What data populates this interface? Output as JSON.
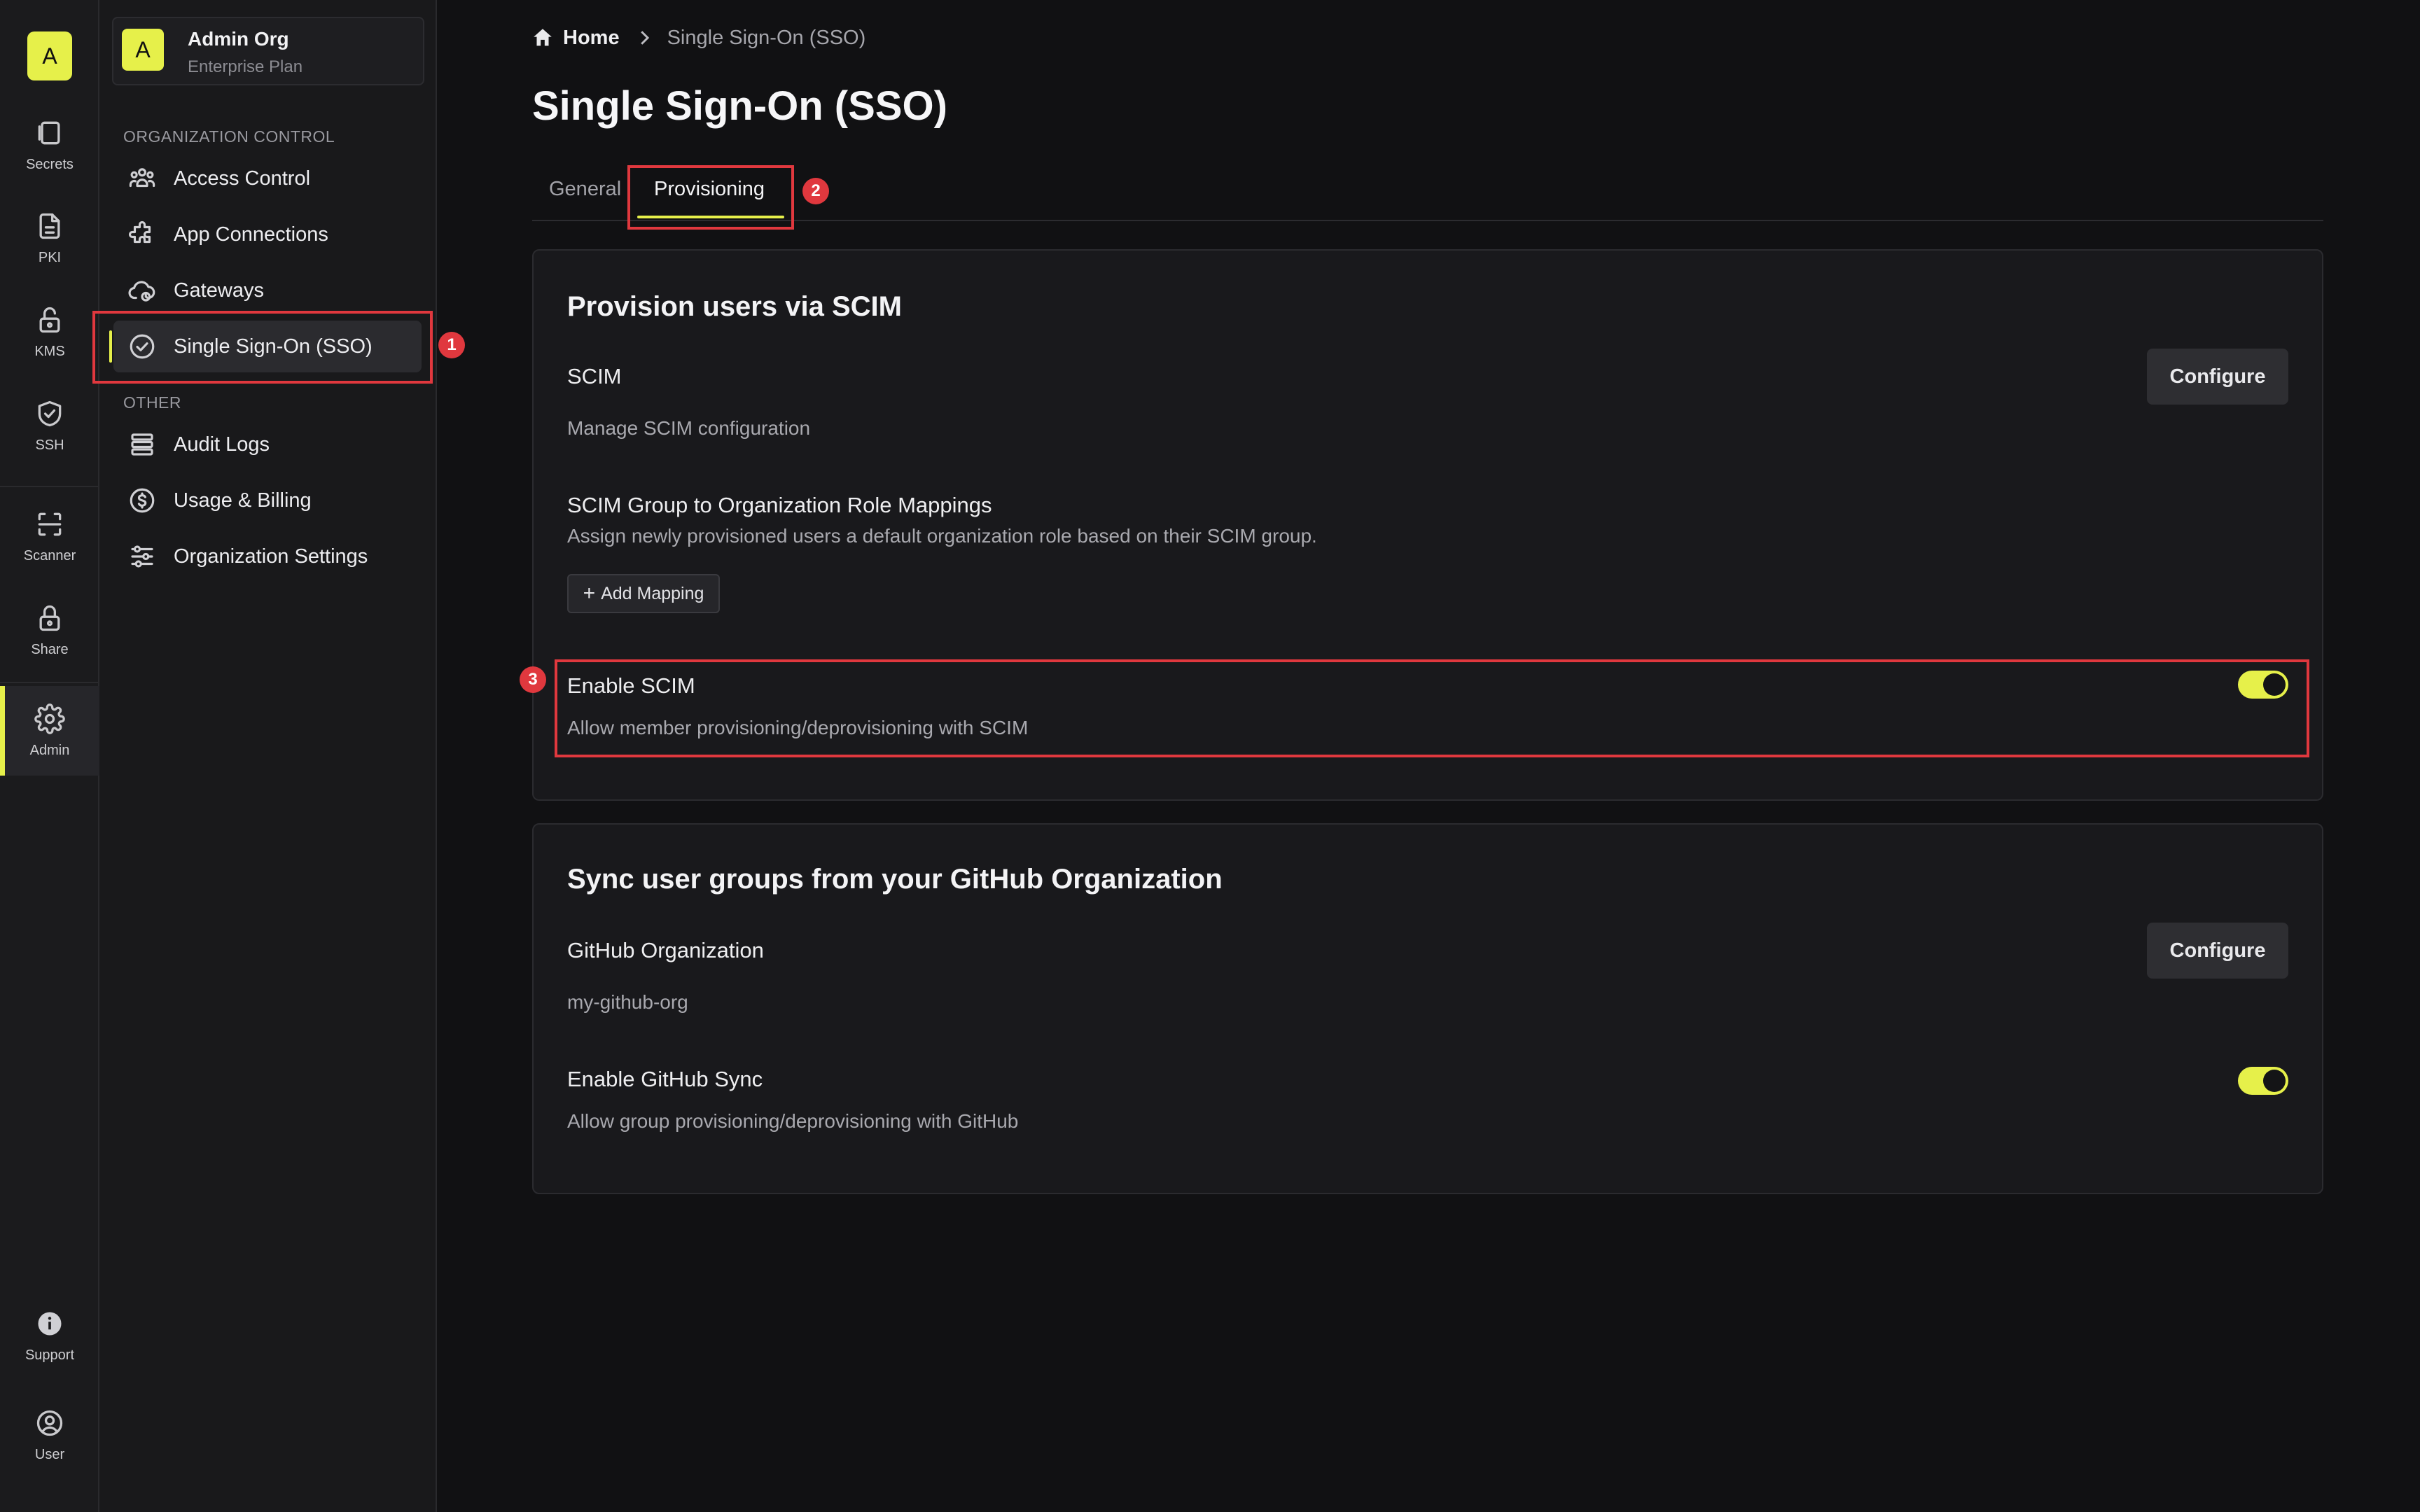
{
  "rail": {
    "logo_letter": "A",
    "items": [
      {
        "label": "Secrets",
        "icon": "secrets-icon"
      },
      {
        "label": "PKI",
        "icon": "document-icon"
      },
      {
        "label": "KMS",
        "icon": "lock-open-icon"
      },
      {
        "label": "SSH",
        "icon": "shield-check-icon"
      },
      {
        "label": "Scanner",
        "icon": "scan-icon"
      },
      {
        "label": "Share",
        "icon": "lock-icon"
      },
      {
        "label": "Admin",
        "icon": "gear-icon"
      }
    ],
    "active_item": "Admin",
    "bottom_items": [
      {
        "label": "Support",
        "icon": "info-icon"
      },
      {
        "label": "User",
        "icon": "user-icon"
      }
    ]
  },
  "org": {
    "avatar_letter": "A",
    "name": "Admin Org",
    "plan": "Enterprise Plan"
  },
  "sidebar": {
    "section_org_label": "ORGANIZATION CONTROL",
    "org_items": [
      {
        "label": "Access Control",
        "icon": "users-icon"
      },
      {
        "label": "App Connections",
        "icon": "puzzle-icon"
      },
      {
        "label": "Gateways",
        "icon": "cloud-icon"
      },
      {
        "label": "Single Sign-On (SSO)",
        "icon": "check-circle-icon"
      }
    ],
    "active_item": "Single Sign-On (SSO)",
    "section_other_label": "OTHER",
    "other_items": [
      {
        "label": "Audit Logs",
        "icon": "list-icon"
      },
      {
        "label": "Usage & Billing",
        "icon": "dollar-icon"
      },
      {
        "label": "Organization Settings",
        "icon": "sliders-icon"
      }
    ]
  },
  "breadcrumb": {
    "home": "Home",
    "current": "Single Sign-On (SSO)"
  },
  "page_title": "Single Sign-On (SSO)",
  "tabs": [
    {
      "label": "General",
      "active": false
    },
    {
      "label": "Provisioning",
      "active": true
    }
  ],
  "annotations": [
    "1",
    "2",
    "3"
  ],
  "scim_card": {
    "title": "Provision users via SCIM",
    "scim_label": "SCIM",
    "scim_desc": "Manage SCIM configuration",
    "configure_label": "Configure",
    "mapping_title": "SCIM Group to Organization Role Mappings",
    "mapping_desc": "Assign newly provisioned users a default organization role based on their SCIM group.",
    "add_mapping_label": "Add Mapping",
    "enable_label": "Enable SCIM",
    "enable_desc": "Allow member provisioning/deprovisioning with SCIM",
    "enable_on": true
  },
  "github_card": {
    "title": "Sync user groups from your GitHub Organization",
    "org_label": "GitHub Organization",
    "org_value": "my-github-org",
    "configure_label": "Configure",
    "sync_label": "Enable GitHub Sync",
    "sync_desc": "Allow group provisioning/deprovisioning with GitHub",
    "sync_on": true
  },
  "colors": {
    "accent": "#e6f04a",
    "annotation": "#e0383e",
    "background": "#111113"
  }
}
